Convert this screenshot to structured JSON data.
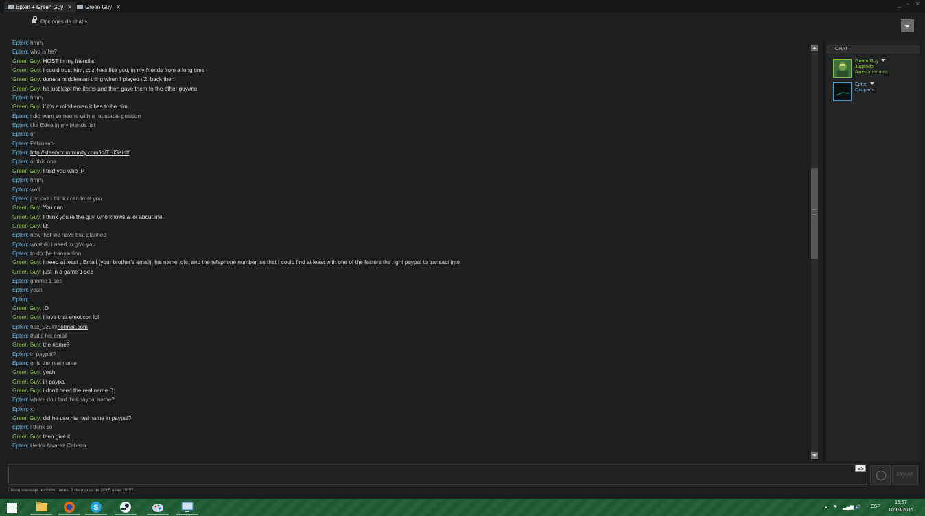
{
  "tabs": [
    {
      "label": "Epten + Green Guy",
      "active": true
    },
    {
      "label": "Green Guy",
      "active": false
    }
  ],
  "window": {
    "controls": "_ ▫ ✕"
  },
  "header": {
    "options_label": "Opciones de chat ▾"
  },
  "colors": {
    "epten": "#6db3de",
    "green_guy": "#8cc341",
    "taskbar": "#1f5d33"
  },
  "chat_lines": [
    {
      "who": "Epten",
      "sep": ": ",
      "msg": "hmm"
    },
    {
      "who": "Epten",
      "sep": ": ",
      "msg": "who is he?"
    },
    {
      "who": "Green Guy",
      "sep": ": ",
      "msg": "HOST in my friendlist"
    },
    {
      "who": "Green Guy",
      "sep": ": ",
      "msg": "I could trust him, cuz' he's like you, in my friends from a long time"
    },
    {
      "who": "Green Guy",
      "sep": ": ",
      "msg": "done a middleman thing when I played tf2, back then"
    },
    {
      "who": "Green Guy",
      "sep": ": ",
      "msg": "he just kept the items and then gave them to the other guy/me"
    },
    {
      "who": "Epten",
      "sep": ": ",
      "msg": "hmm"
    },
    {
      "who": "Green Guy",
      "sep": ": ",
      "msg": "if it's a middleman it has to be him"
    },
    {
      "who": "Epten",
      "sep": ": ",
      "msg": "i did want someone with a reputable position"
    },
    {
      "who": "Epten",
      "sep": ": ",
      "msg": "like Edea in my friends list"
    },
    {
      "who": "Epten",
      "sep": ": ",
      "msg": "or"
    },
    {
      "who": "Epten",
      "sep": ": ",
      "msg": "Fabinaab"
    },
    {
      "who": "Epten",
      "sep": ": ",
      "msg": "http://steamcommunity.com/id/THISaint/",
      "link": true
    },
    {
      "who": "Epten",
      "sep": ": ",
      "msg": "or this one"
    },
    {
      "who": "Green Guy",
      "sep": ": ",
      "msg": "I told you who :P"
    },
    {
      "who": "Epten",
      "sep": ": ",
      "msg": "hmm"
    },
    {
      "who": "Epten",
      "sep": ": ",
      "msg": "well"
    },
    {
      "who": "Epten",
      "sep": ": ",
      "msg": "just cuz i think i can trust you"
    },
    {
      "who": "Green Guy",
      "sep": ": ",
      "msg": "You can"
    },
    {
      "who": "Green Guy",
      "sep": ": ",
      "msg": "I think you're the guy, who knows a lot about me"
    },
    {
      "who": "Green Guy",
      "sep": ": ",
      "msg": "D:"
    },
    {
      "who": "Epten",
      "sep": ": ",
      "msg": "now that we have that planned"
    },
    {
      "who": "Epten",
      "sep": ": ",
      "msg": "what do i need to give you"
    },
    {
      "who": "Epten",
      "sep": ": ",
      "msg": "to do the transaction"
    },
    {
      "who": "Green Guy",
      "sep": ": ",
      "msg": "I need at least : Email (your brother's email), his name, ofc, and the telephone number, so that I could find at least with one of the factors the right paypal to transact into"
    },
    {
      "who": "Green Guy",
      "sep": ": ",
      "msg": "just in a game 1 sec"
    },
    {
      "who": "Epten",
      "sep": ": ",
      "msg": "gimme 1 sec"
    },
    {
      "who": "Epten",
      "sep": ": ",
      "msg": "yeah"
    },
    {
      "who": "Epten",
      "sep": ":",
      "msg": ""
    },
    {
      "who": "Green Guy",
      "sep": ": ",
      "msg": ":D"
    },
    {
      "who": "Green Guy",
      "sep": ": ",
      "msg": "I love that emoticon lol"
    },
    {
      "who": "Epten",
      "sep": ": ",
      "msg_pre": "hac_929@",
      "msg": "hotmail.com",
      "link": true
    },
    {
      "who": "Epten",
      "sep": ": ",
      "msg": "that's his email"
    },
    {
      "who": "Green Guy",
      "sep": ": ",
      "msg": "the name?"
    },
    {
      "who": "Epten",
      "sep": ": ",
      "msg": "in paypal?"
    },
    {
      "who": "Epten",
      "sep": ": ",
      "msg": "or is the real name"
    },
    {
      "who": "Green Guy",
      "sep": ": ",
      "msg": "yeah"
    },
    {
      "who": "Green Guy",
      "sep": ": ",
      "msg": "in paypal"
    },
    {
      "who": "Green Guy",
      "sep": ": ",
      "msg": "i don't need the real name D:"
    },
    {
      "who": "Epten",
      "sep": ": ",
      "msg": "where do i find that paypal name?"
    },
    {
      "who": "Epten",
      "sep": ": ",
      "msg": "x)"
    },
    {
      "who": "Green Guy",
      "sep": ": ",
      "msg": "did he use his real name in paypal?"
    },
    {
      "who": "Epten",
      "sep": ": ",
      "msg": "i think so"
    },
    {
      "who": "Green Guy",
      "sep": ": ",
      "msg": "then give it"
    },
    {
      "who": "Epten",
      "sep": ": ",
      "msg": "Heitor Alvarez Cabeza"
    }
  ],
  "sidebar": {
    "header": "—  CHAT",
    "friends": [
      {
        "name": "Green Guy",
        "status_line1": "Jugando",
        "status_line2": "Awesomenauts"
      },
      {
        "name": "Epten",
        "status_line1": "Ocupado",
        "status_line2": ""
      }
    ]
  },
  "input": {
    "value": "",
    "placeholder": "",
    "lang": "ES",
    "send_label": "ENVIAR"
  },
  "status_bar": {
    "text": "Último mensaje recibido: lunes, 2 de marzo de 2015 a las 15:57"
  },
  "taskbar": {
    "apps": [
      "windows-start",
      "file-explorer",
      "firefox",
      "skype",
      "steam",
      "paint",
      "remote-desktop"
    ],
    "tray_lang": "ESP",
    "time": "15:57",
    "date": "02/03/2015"
  }
}
